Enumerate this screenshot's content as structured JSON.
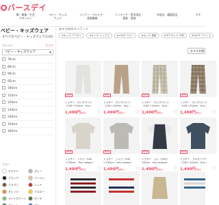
{
  "header": {
    "logo_text": "バースデイ",
    "nav": [
      "靴・雑貨・生活\nマタニティ",
      "ベビー・キッズ\nウェア",
      "インナー・パジャマ・\n部屋着着",
      "インテリア・室内用品・\n寝具・収納",
      "学用品・通園用品",
      "ガチ"
    ]
  },
  "sidebar": {
    "category_title": "ベビー・キッズウェア",
    "category_sub": "すべてのベビー・キッズウェア(140)",
    "category_label": "カテゴリ",
    "clear_label": "クリア",
    "category_value": "ベビー・キッズウェア",
    "size_label": "サイズ",
    "sizes": [
      "70cm",
      "80cm",
      "90cm",
      "95cm",
      "100cm",
      "110cm",
      "120cm",
      "130cm",
      "140cm",
      "150cm",
      "160cm"
    ],
    "color_label": "カラー",
    "colors": [
      {
        "name": "ホワイト",
        "hex": "#ffffff"
      },
      {
        "name": "グレー",
        "hex": "#b5b5b5"
      },
      {
        "name": "ブラック",
        "hex": "#222222"
      },
      {
        "name": "ベージュ",
        "hex": "#d8c6a4"
      },
      {
        "name": "ブラウン",
        "hex": "#7a5230"
      },
      {
        "name": "レッド",
        "hex": "#c8343a"
      },
      {
        "name": "オレンジ",
        "hex": "#ec8a2e"
      },
      {
        "name": "イエロー",
        "hex": "#f1d22f"
      },
      {
        "name": "ライトグリーン",
        "hex": "#8cc06b"
      },
      {
        "name": "カーキ",
        "hex": "#5f6b3a"
      },
      {
        "name": "グリーン",
        "hex": "#2e8a48"
      },
      {
        "name": "ブルー",
        "hex": "#3b73c4"
      }
    ]
  },
  "main": {
    "recommend_label": "おすすめのキーワード",
    "chips": [
      "#キッズ アウター",
      "#キッズ トップス",
      "#chil子 ベビー",
      "#キッズ 長袖",
      "#ボアガンド 子供",
      "#chil子 フリース"
    ],
    "filter_label": "おすすめ順",
    "products": [
      {
        "title": "トゥザー　ロングパンツ",
        "sub": "（100〜120cm　tiny・",
        "price": "1,490円",
        "tax": "(税込)",
        "is_new": true,
        "color": "#e4e2df",
        "shape": "pants"
      },
      {
        "title": "トゥザー　ロングパンツ",
        "sub": "（100〜120cm　tiny・",
        "price": "1,490円",
        "tax": "(税込)",
        "is_new": true,
        "color": "#b9a187",
        "shape": "pants"
      },
      {
        "title": "トゥザー　ロングパンツ",
        "sub": "（100〜120cm　tiny・",
        "price": "1,490円",
        "tax": "(税込)",
        "is_new": true,
        "color": "#c4bca8",
        "shape": "pants-check"
      },
      {
        "title": "トゥザー　ロングパンツ",
        "sub": "（100〜120cm　tiny・",
        "price": "1,490円",
        "tax": "(税込)",
        "is_new": true,
        "color": "#8d7c62",
        "shape": "pants-check"
      },
      {
        "title": "トゥザー　シャツ（100",
        "sub": "〜130cm　tiny mason）",
        "price": "1,490円",
        "tax": "(税込)",
        "is_new": true,
        "color": "#d9d4ca",
        "shape": "shirt"
      },
      {
        "title": "トゥザー　シャツ（100",
        "sub": "〜130cm　tiny mason）",
        "price": "1,490円",
        "tax": "(税込)",
        "is_new": true,
        "color": "#bcbab5",
        "shape": "shirt"
      },
      {
        "title": "トゥザー　ジレ（100〜",
        "sub": "130cm　tiny mason）",
        "price": "1,490円",
        "tax": "(税込)",
        "is_new": true,
        "color": "#333a44",
        "shape": "vest"
      },
      {
        "title": "トゥザー　ブルオーバー",
        "sub": "（100〜120cm　tiny・",
        "price": "1,490円",
        "tax": "(税込)",
        "is_new": true,
        "color": "#3f4f5f",
        "shape": "shirt"
      }
    ]
  }
}
